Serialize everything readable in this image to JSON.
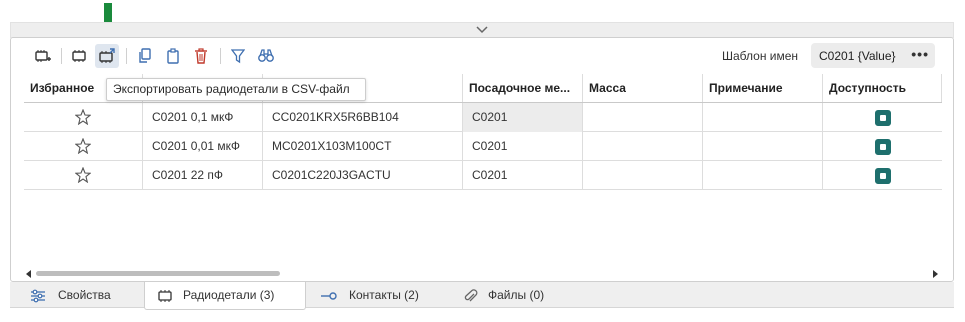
{
  "toolbar": {
    "name_template_label": "Шаблон имен",
    "name_template_value": "C0201 {Value}",
    "more_label": "•••"
  },
  "tooltip": "Экспортировать радиодетали в CSV-файл",
  "table": {
    "columns": [
      "Избранное",
      "",
      "",
      "Посадочное ме...",
      "Масса",
      "Примечание",
      "Доступность"
    ],
    "rows": [
      {
        "name": "C0201 0,1 мкФ",
        "part": "CC0201KRX5R6BB104",
        "footprint": "C0201",
        "mass": "",
        "note": ""
      },
      {
        "name": "C0201 0,01 мкФ",
        "part": "MC0201X103M100CT",
        "footprint": "C0201",
        "mass": "",
        "note": ""
      },
      {
        "name": "C0201 22 пФ",
        "part": "C0201C220J3GACTU",
        "footprint": "C0201",
        "mass": "",
        "note": ""
      }
    ]
  },
  "tabs": [
    {
      "label": "Свойства",
      "icon": "sliders-icon"
    },
    {
      "label": "Радиодетали (3)",
      "icon": "chip-icon"
    },
    {
      "label": "Контакты (2)",
      "icon": "pin-icon"
    },
    {
      "label": "Файлы (0)",
      "icon": "paperclip-icon"
    }
  ],
  "colors": {
    "accent": "#3f6fb0",
    "delete": "#c0392b",
    "arrow": "#1a8a3c",
    "availability": "#1e6f6d"
  }
}
